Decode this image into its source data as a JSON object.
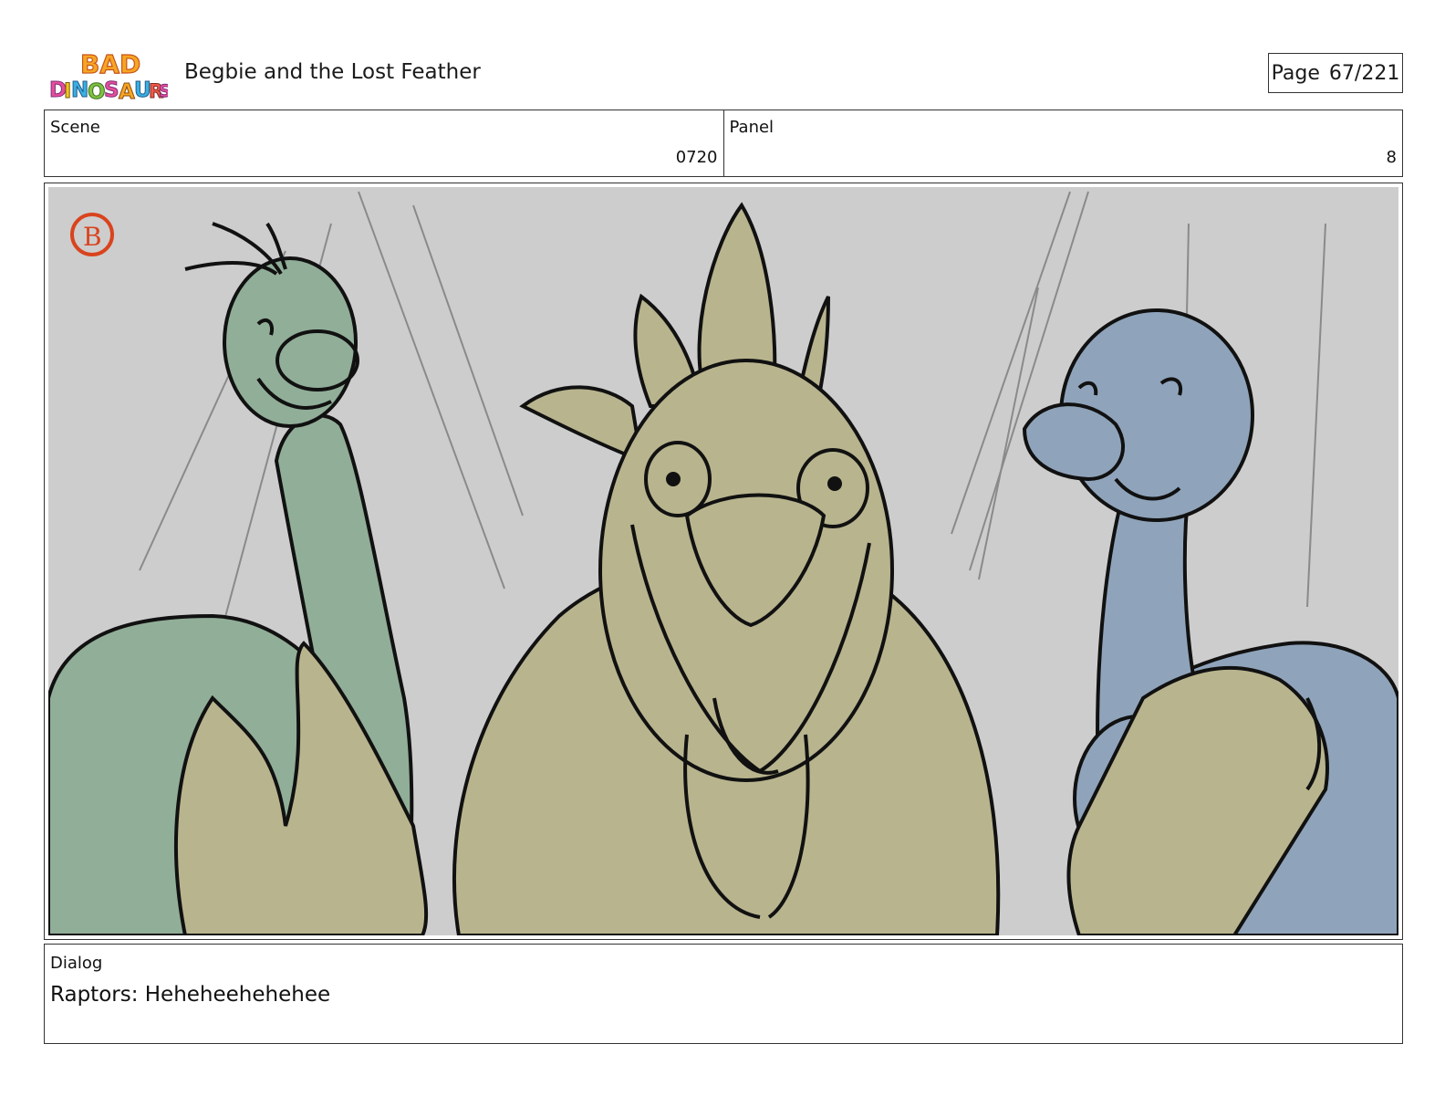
{
  "header": {
    "logo_text": "BAD DINOSAURS",
    "title": "Begbie and the Lost Feather",
    "page_label": "Page",
    "page_number": "67/221"
  },
  "info": {
    "scene_label": "Scene",
    "scene_value": "0720",
    "panel_label": "Panel",
    "panel_value": "8"
  },
  "panel": {
    "corner_mark": "B",
    "colors": {
      "background": "#cdcdcd",
      "green_raptor": "#91ae98",
      "center_raptor": "#b8b48e",
      "blue_raptor": "#8fa4bb",
      "ink": "#111111",
      "corner_mark": "#d9441e"
    }
  },
  "dialog": {
    "label": "Dialog",
    "text": "Raptors: Heheheehehehee"
  }
}
